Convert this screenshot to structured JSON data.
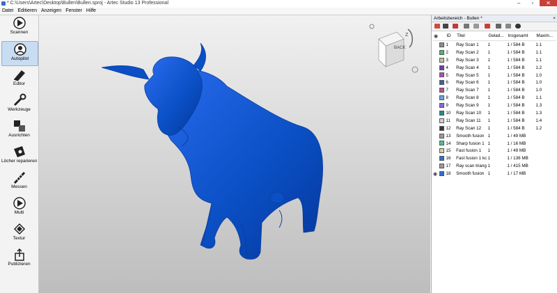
{
  "window": {
    "title": "* C:\\Users\\Artec\\Desktop\\Bullen\\Bullen.sproj - Artec Studio 13 Professional",
    "minimize": "–",
    "maximize": "▫",
    "close": "✕"
  },
  "menu": [
    "Datei",
    "Editieren",
    "Anzeigen",
    "Fenster",
    "Hilfe"
  ],
  "tools": [
    {
      "label": "Scannen",
      "icon": "play-icon"
    },
    {
      "label": "Autopilot",
      "icon": "autopilot-icon",
      "active": true
    },
    {
      "label": "Editor",
      "icon": "eraser-icon"
    },
    {
      "label": "Werkzeuge",
      "icon": "wrench-icon"
    },
    {
      "label": "Ausrichten",
      "icon": "align-icon"
    },
    {
      "label": "Löcher reparieren",
      "icon": "patch-icon"
    },
    {
      "label": "Messen",
      "icon": "ruler-icon"
    },
    {
      "label": "Multi",
      "icon": "multi-icon"
    },
    {
      "label": "Textur",
      "icon": "texture-icon"
    },
    {
      "label": "Publizieren",
      "icon": "share-icon"
    }
  ],
  "viewport": {
    "nav_cube_face": "BACK",
    "axis_label": "Z",
    "model_color": "#0a4fc4"
  },
  "panel": {
    "title": "Arbeitsbereich - Bullen *",
    "close": "×",
    "columns": [
      "ID",
      "Titel",
      "Gelad...",
      "Insgesamt",
      "Maxim..."
    ],
    "rows": [
      {
        "id": "1",
        "title": "Ray Scan 1",
        "loaded": "1",
        "total": "1 / 584 B",
        "max": "1.1",
        "color": "#8c8c8c",
        "visible": false
      },
      {
        "id": "2",
        "title": "Ray Scan 2",
        "loaded": "1",
        "total": "1 / 584 B",
        "max": "1.1",
        "color": "#48b87e",
        "visible": false
      },
      {
        "id": "3",
        "title": "Ray Scan 3",
        "loaded": "1",
        "total": "1 / 584 B",
        "max": "1.1",
        "color": "#b7c79a",
        "visible": false
      },
      {
        "id": "4",
        "title": "Ray Scan 4",
        "loaded": "1",
        "total": "1 / 584 B",
        "max": "1.2",
        "color": "#6a3fb0",
        "visible": false
      },
      {
        "id": "5",
        "title": "Ray Scan 5",
        "loaded": "1",
        "total": "1 / 584 B",
        "max": "1.0",
        "color": "#b04fb5",
        "visible": false
      },
      {
        "id": "6",
        "title": "Ray Scan 6",
        "loaded": "1",
        "total": "1 / 584 B",
        "max": "1.0",
        "color": "#3f5fb0",
        "visible": false
      },
      {
        "id": "7",
        "title": "Ray Scan 7",
        "loaded": "1",
        "total": "1 / 584 B",
        "max": "1.0",
        "color": "#b85090",
        "visible": false
      },
      {
        "id": "8",
        "title": "Ray Scan 8",
        "loaded": "1",
        "total": "1 / 584 B",
        "max": "1.1",
        "color": "#6fa0d8",
        "visible": false
      },
      {
        "id": "9",
        "title": "Ray Scan 9",
        "loaded": "1",
        "total": "1 / 584 B",
        "max": "1.3",
        "color": "#7e6fd0",
        "visible": false
      },
      {
        "id": "10",
        "title": "Ray Scan 10",
        "loaded": "1",
        "total": "1 / 584 B",
        "max": "1.3",
        "color": "#2a8a8a",
        "visible": false
      },
      {
        "id": "11",
        "title": "Ray Scan 11",
        "loaded": "1",
        "total": "1 / 584 B",
        "max": "1.4",
        "color": "#d0d0d0",
        "visible": false
      },
      {
        "id": "12",
        "title": "Ray Scan 12",
        "loaded": "1",
        "total": "1 / 584 B",
        "max": "1.2",
        "color": "#3a3a3a",
        "visible": false
      },
      {
        "id": "13",
        "title": "Smooth fusion",
        "loaded": "1",
        "total": "1 / 49 MB",
        "max": "",
        "color": "#9a9a9a",
        "visible": false
      },
      {
        "id": "14",
        "title": "Sharp fusion 1",
        "loaded": "1",
        "total": "1 / 16 MB",
        "max": "",
        "color": "#4fc08f",
        "visible": false
      },
      {
        "id": "15",
        "title": "Fast fusion 1",
        "loaded": "1",
        "total": "1 / 49 MB",
        "max": "",
        "color": "#c9d7a0",
        "visible": false
      },
      {
        "id": "16",
        "title": "Fast fusion 1 kc",
        "loaded": "1",
        "total": "1 / 136 MB",
        "max": "",
        "color": "#2f6fd0",
        "visible": false
      },
      {
        "id": "17",
        "title": "Ray scan triang",
        "loaded": "1",
        "total": "1 / 415 MB",
        "max": "",
        "color": "#9a9aa0",
        "visible": false
      },
      {
        "id": "18",
        "title": "Smooth fusion",
        "loaded": "1",
        "total": "1 / 17 MB",
        "max": "",
        "color": "#2f6fd0",
        "visible": true
      }
    ]
  }
}
